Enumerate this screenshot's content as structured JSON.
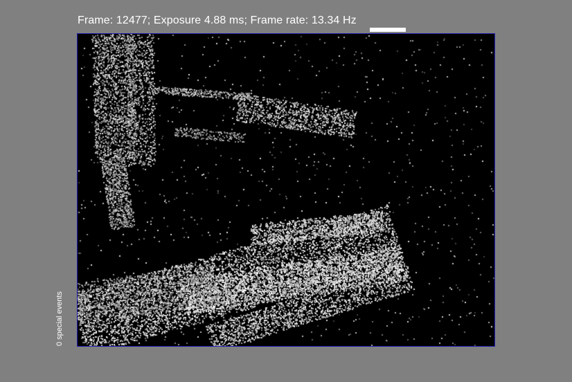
{
  "status": {
    "text": "Frame: 12477; Exposure 4.88 ms; Frame rate: 13.34 Hz",
    "frame": 12477,
    "exposure_ms": 4.88,
    "frame_rate_hz": 13.34
  },
  "side_label": {
    "text": "0 special events"
  },
  "colors": {
    "background": "#808080",
    "display_background": "#000000",
    "display_border": "#1f1fb4",
    "text": "#ffffff"
  }
}
